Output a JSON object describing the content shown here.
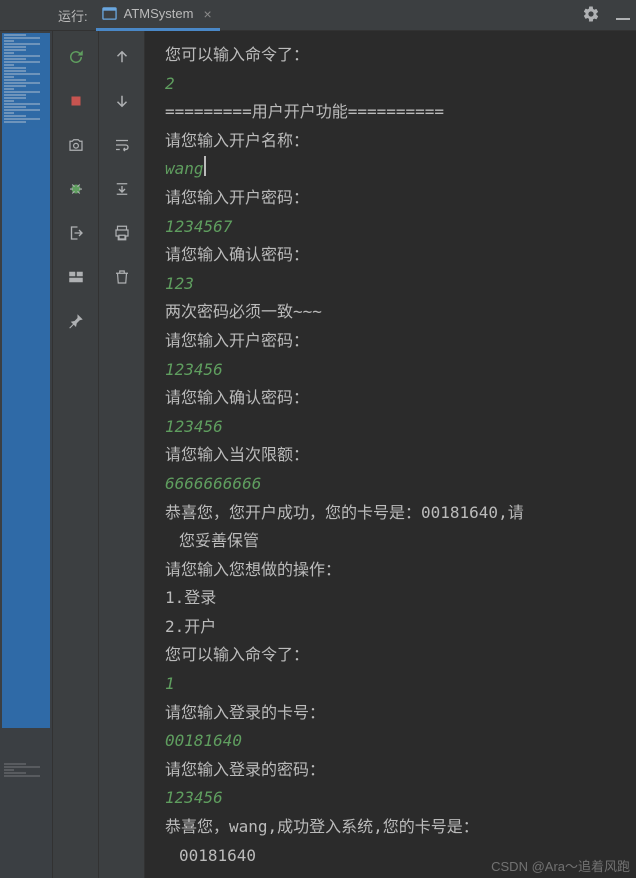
{
  "topbar": {
    "run_label": "运行:",
    "tab_title": "ATMSystem",
    "tab_close": "×"
  },
  "console": {
    "lines": [
      {
        "t": "out",
        "v": "您可以输入命令了："
      },
      {
        "t": "in",
        "v": "2"
      },
      {
        "t": "out",
        "v": "=========用户开户功能=========="
      },
      {
        "t": "out",
        "v": "请您输入开户名称："
      },
      {
        "t": "in",
        "v": "wang",
        "cursor": true
      },
      {
        "t": "out",
        "v": "请您输入开户密码："
      },
      {
        "t": "in",
        "v": "1234567"
      },
      {
        "t": "out",
        "v": "请您输入确认密码："
      },
      {
        "t": "in",
        "v": "123"
      },
      {
        "t": "out",
        "v": "两次密码必须一致~~~"
      },
      {
        "t": "out",
        "v": "请您输入开户密码："
      },
      {
        "t": "in",
        "v": "123456"
      },
      {
        "t": "out",
        "v": "请您输入确认密码："
      },
      {
        "t": "in",
        "v": "123456"
      },
      {
        "t": "out",
        "v": "请您输入当次限额："
      },
      {
        "t": "in",
        "v": "6666666666"
      },
      {
        "t": "out",
        "v": "恭喜您，您开户成功，您的卡号是：00181640,请"
      },
      {
        "t": "out",
        "v": "您妥善保管",
        "indent": true
      },
      {
        "t": "out",
        "v": "请您输入您想做的操作："
      },
      {
        "t": "out",
        "v": "1.登录"
      },
      {
        "t": "out",
        "v": "2.开户"
      },
      {
        "t": "out",
        "v": "您可以输入命令了："
      },
      {
        "t": "in",
        "v": "1"
      },
      {
        "t": "out",
        "v": "请您输入登录的卡号："
      },
      {
        "t": "in",
        "v": "00181640"
      },
      {
        "t": "out",
        "v": "请您输入登录的密码："
      },
      {
        "t": "in",
        "v": "123456"
      },
      {
        "t": "out",
        "v": "恭喜您，wang,成功登入系统,您的卡号是："
      },
      {
        "t": "out",
        "v": "00181640",
        "indent": true
      }
    ]
  },
  "watermark": "CSDN @Ara～追着风跑"
}
